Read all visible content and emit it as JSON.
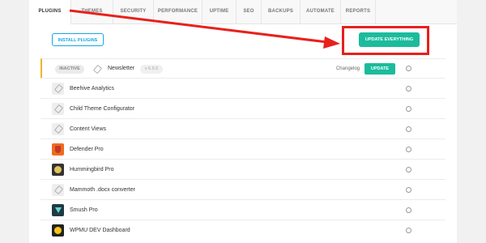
{
  "tabs": [
    "PLUGINS",
    "THEMES",
    "SECURITY",
    "PERFORMANCE",
    "UPTIME",
    "SEO",
    "BACKUPS",
    "AUTOMATE",
    "REPORTS"
  ],
  "toolbar": {
    "install_label": "INSTALL PLUGINS",
    "update_all_label": "UPDATE EVERYTHING"
  },
  "newsletter": {
    "status": "INACTIVE",
    "name": "Newsletter",
    "version": "v 6.5.6",
    "changelog": "Changelog",
    "update_label": "UPDATE"
  },
  "plugins": [
    {
      "name": "Beehive Analytics",
      "icon": "plug-icon"
    },
    {
      "name": "Child Theme Configurator",
      "icon": "plug-icon"
    },
    {
      "name": "Content Views",
      "icon": "plug-icon"
    },
    {
      "name": "Defender Pro",
      "icon": "defender-icon"
    },
    {
      "name": "Hummingbird Pro",
      "icon": "hummingbird-icon"
    },
    {
      "name": "Mammoth .docx converter",
      "icon": "plug-icon"
    },
    {
      "name": "Smush Pro",
      "icon": "smush-icon"
    },
    {
      "name": "WPMU DEV Dashboard",
      "icon": "wpmudev-icon"
    }
  ],
  "colors": {
    "accent": "#1abc9c",
    "link": "#17a8e3",
    "annotation": "#e8201c",
    "inactive_marker": "#f0b429"
  }
}
